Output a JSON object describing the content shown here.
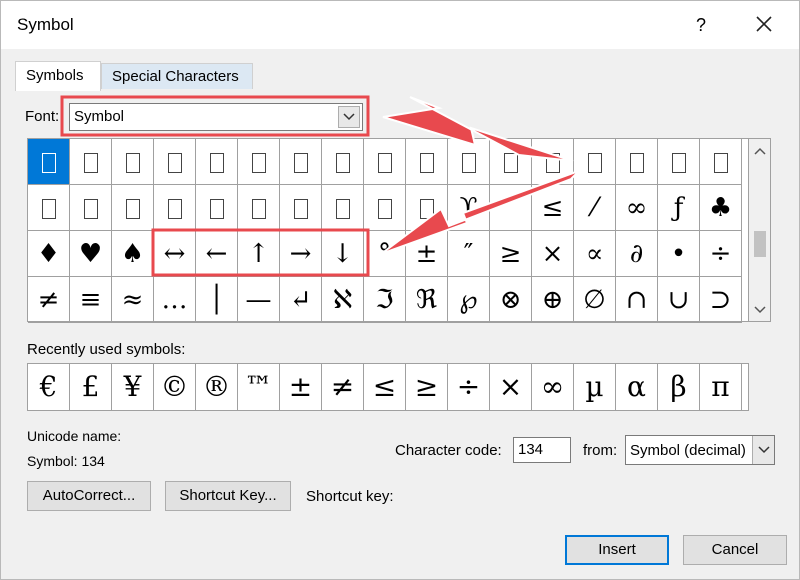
{
  "dialog": {
    "title": "Symbol",
    "help_label": "?",
    "close_icon": "close-icon"
  },
  "tabs": [
    {
      "label": "Symbols",
      "active": true
    },
    {
      "label": "Special Characters",
      "active": false
    }
  ],
  "font": {
    "label": "Font:",
    "value": "Symbol"
  },
  "symbol_grid": {
    "selected_index": 0,
    "rows": [
      [
        "",
        "",
        "",
        "",
        "",
        "",
        "",
        "",
        "",
        "",
        "",
        "",
        "",
        "",
        "",
        "",
        ""
      ],
      [
        "",
        "",
        "",
        "",
        "",
        "",
        "",
        "",
        "",
        "",
        "ϒ",
        "′",
        "≤",
        "⁄",
        "∞",
        "ƒ",
        "♣"
      ],
      [
        "♦",
        "♥",
        "♠",
        "↔",
        "←",
        "↑",
        "→",
        "↓",
        "°",
        "±",
        "″",
        "≥",
        "×",
        "∝",
        "∂",
        "•",
        "÷"
      ],
      [
        "≠",
        "≡",
        "≈",
        "…",
        "│",
        "—",
        "↵",
        "ℵ",
        "ℑ",
        "ℜ",
        "℘",
        "⊗",
        "⊕",
        "∅",
        "∩",
        "∪",
        "⊃"
      ]
    ],
    "missing_glyph": "⎕"
  },
  "recent": {
    "label": "Recently used symbols:",
    "symbols": [
      "€",
      "£",
      "¥",
      "©",
      "®",
      "™",
      "±",
      "≠",
      "≤",
      "≥",
      "÷",
      "×",
      "∞",
      "µ",
      "α",
      "β",
      "π"
    ]
  },
  "unicode": {
    "name_label": "Unicode name:",
    "value": "Symbol: 134"
  },
  "character_code": {
    "label": "Character code:",
    "value": "134",
    "from_label": "from:",
    "from_value": "Symbol (decimal)"
  },
  "buttons": {
    "autocorrect": "AutoCorrect...",
    "shortcut_key": "Shortcut Key...",
    "shortcut_key_label": "Shortcut key:",
    "insert": "Insert",
    "cancel": "Cancel"
  },
  "annotation": {
    "color": "#e8494e"
  }
}
